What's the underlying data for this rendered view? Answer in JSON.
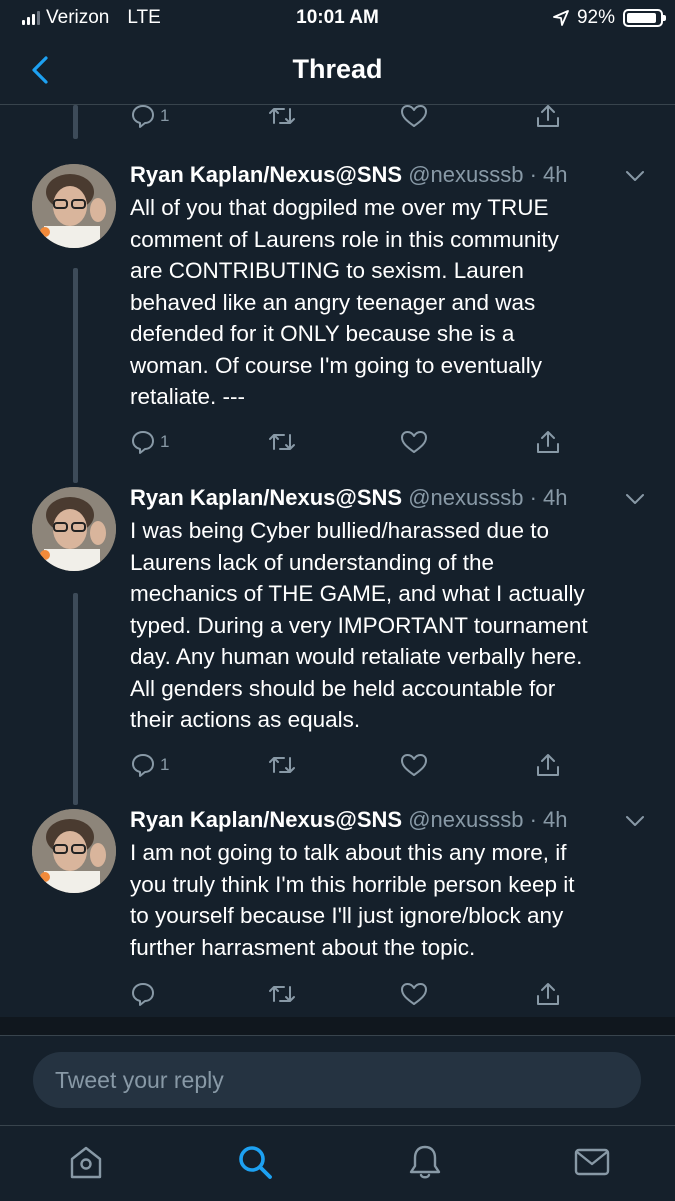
{
  "status_bar": {
    "carrier": "Verizon",
    "network": "LTE",
    "time": "10:01 AM",
    "battery": "92%",
    "battery_level": 0.92
  },
  "header": {
    "title": "Thread"
  },
  "colors": {
    "accent": "#1da1f2",
    "background": "#15202b",
    "muted": "#8899a6"
  },
  "previous_tweet_actions": {
    "reply_count": "1"
  },
  "tweets": [
    {
      "name": "Ryan Kaplan/Nexus@SNS",
      "meta": "@nexusssb · 4h",
      "lines": [
        "All of you that dogpiled me over my TRUE",
        "comment of Laurens role in this community",
        "are CONTRIBUTING to sexism. Lauren",
        "behaved like an angry teenager and was",
        "defended for it ONLY because she is a",
        "woman. Of course I'm going to eventually",
        "retaliate. ---"
      ],
      "reply_count": "1"
    },
    {
      "name": "Ryan Kaplan/Nexus@SNS",
      "meta": "@nexusssb · 4h",
      "lines": [
        "I was being Cyber bullied/harassed due to",
        "Laurens lack of understanding of the",
        "mechanics of THE GAME, and what I actually",
        "typed. During a very IMPORTANT tournament",
        "day. Any human would retaliate verbally here.",
        "All genders should be held accountable for",
        "their actions as equals."
      ],
      "reply_count": "1"
    },
    {
      "name": "Ryan Kaplan/Nexus@SNS",
      "meta": "@nexusssb · 4h",
      "lines": [
        "I am not going to talk about this any more, if",
        "you truly think I'm this horrible person keep it",
        "to yourself because I'll just ignore/block any",
        "further harrasment about the topic."
      ],
      "reply_count": ""
    }
  ],
  "reply": {
    "placeholder": "Tweet your reply"
  },
  "tabs": [
    {
      "icon": "home-icon"
    },
    {
      "icon": "search-icon",
      "active": true
    },
    {
      "icon": "notifications-icon"
    },
    {
      "icon": "messages-icon"
    }
  ]
}
